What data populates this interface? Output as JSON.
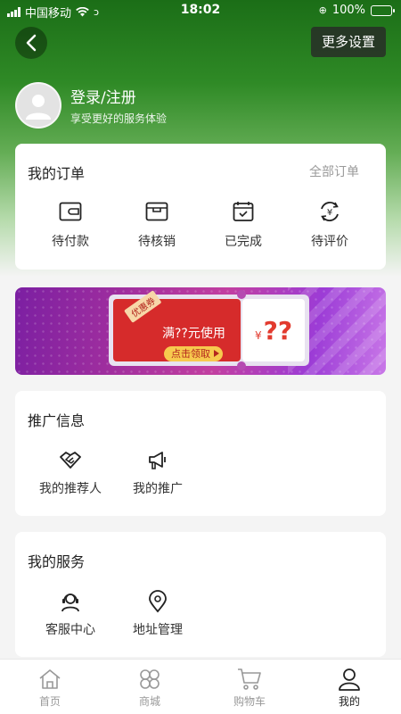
{
  "status_bar": {
    "carrier": "中国移动",
    "time": "18:02",
    "battery": "100%"
  },
  "header": {
    "more_settings": "更多设置"
  },
  "profile": {
    "title": "登录/注册",
    "subtitle": "享受更好的服务体验"
  },
  "orders": {
    "title": "我的订单",
    "all_link": "全部订单",
    "items": [
      {
        "label": "待付款",
        "icon": "wallet-icon"
      },
      {
        "label": "待核销",
        "icon": "box-icon"
      },
      {
        "label": "已完成",
        "icon": "calendar-check-icon"
      },
      {
        "label": "待评价",
        "icon": "yen-refresh-icon"
      }
    ]
  },
  "banner": {
    "tag": "优惠券",
    "text": "满??元使用",
    "button": "点击领取",
    "currency": "¥",
    "amount": "??"
  },
  "promo": {
    "title": "推广信息",
    "items": [
      {
        "label": "我的推荐人",
        "icon": "handshake-icon"
      },
      {
        "label": "我的推广",
        "icon": "megaphone-icon"
      }
    ]
  },
  "service": {
    "title": "我的服务",
    "items": [
      {
        "label": "客服中心",
        "icon": "headset-icon"
      },
      {
        "label": "地址管理",
        "icon": "location-pin-icon"
      }
    ]
  },
  "tabbar": {
    "items": [
      {
        "label": "首页",
        "icon": "home-icon"
      },
      {
        "label": "商城",
        "icon": "grid-icon"
      },
      {
        "label": "购物车",
        "icon": "cart-icon"
      },
      {
        "label": "我的",
        "icon": "user-icon"
      }
    ],
    "active": "我的"
  }
}
